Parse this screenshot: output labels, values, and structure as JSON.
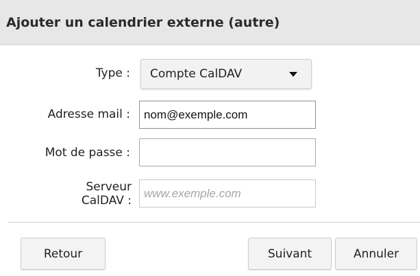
{
  "dialog": {
    "title": "Ajouter un calendrier externe (autre)"
  },
  "form": {
    "type_label": "Type :",
    "type_value": "Compte CalDAV",
    "email_label": "Adresse mail :",
    "email_value": "nom@exemple.com",
    "password_label": "Mot de passe :",
    "password_value": "",
    "server_label": "Serveur CalDAV :",
    "server_value": "",
    "server_placeholder": "www.exemple.com"
  },
  "footer": {
    "back_label": "Retour",
    "next_label": "Suivant",
    "cancel_label": "Annuler"
  },
  "icons": {
    "dropdown": "chevron-down-icon"
  },
  "colors": {
    "titlebar_bg": "#e7e7e7",
    "button_bg": "#f3f3f3"
  }
}
